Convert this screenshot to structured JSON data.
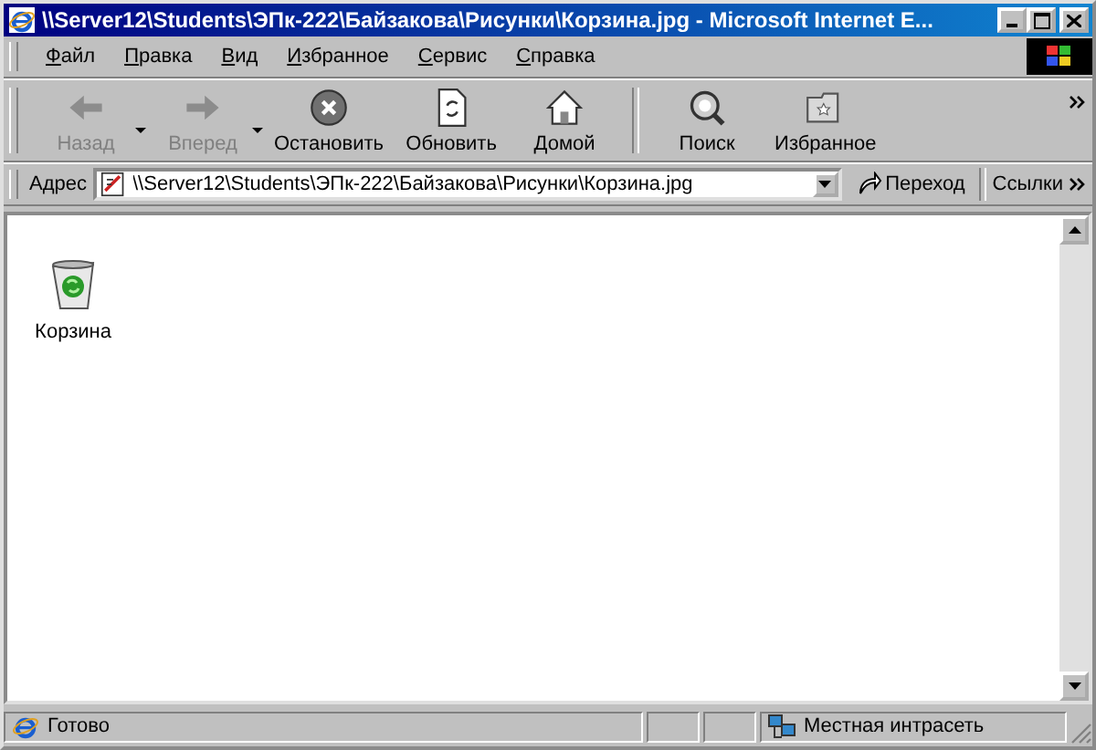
{
  "window": {
    "title": "\\\\Server12\\Students\\ЭПк-222\\Байзакова\\Рисунки\\Корзина.jpg - Microsoft Internet E..."
  },
  "menu": [
    "Файл",
    "Правка",
    "Вид",
    "Избранное",
    "Сервис",
    "Справка"
  ],
  "toolbar": [
    {
      "kind": "back",
      "label": "Назад",
      "disabled": true,
      "dropdown": true
    },
    {
      "kind": "forward",
      "label": "Вперед",
      "disabled": true,
      "dropdown": true
    },
    {
      "kind": "stop",
      "label": "Остановить",
      "disabled": false,
      "dropdown": false
    },
    {
      "kind": "refresh",
      "label": "Обновить",
      "disabled": false,
      "dropdown": false
    },
    {
      "kind": "home",
      "label": "Домой",
      "disabled": false,
      "dropdown": false
    },
    {
      "kind": "search",
      "label": "Поиск",
      "disabled": false,
      "dropdown": false
    },
    {
      "kind": "favorites",
      "label": "Избранное",
      "disabled": false,
      "dropdown": false
    }
  ],
  "address_bar": {
    "label": "Адрес",
    "value": "\\\\Server12\\Students\\ЭПк-222\\Байзакова\\Рисунки\\Корзина.jpg",
    "go": "Переход",
    "links": "Ссылки"
  },
  "content": {
    "icons": [
      {
        "label": "Корзина"
      }
    ]
  },
  "status_bar": {
    "text": "Готово",
    "zone": "Местная интрасеть"
  }
}
